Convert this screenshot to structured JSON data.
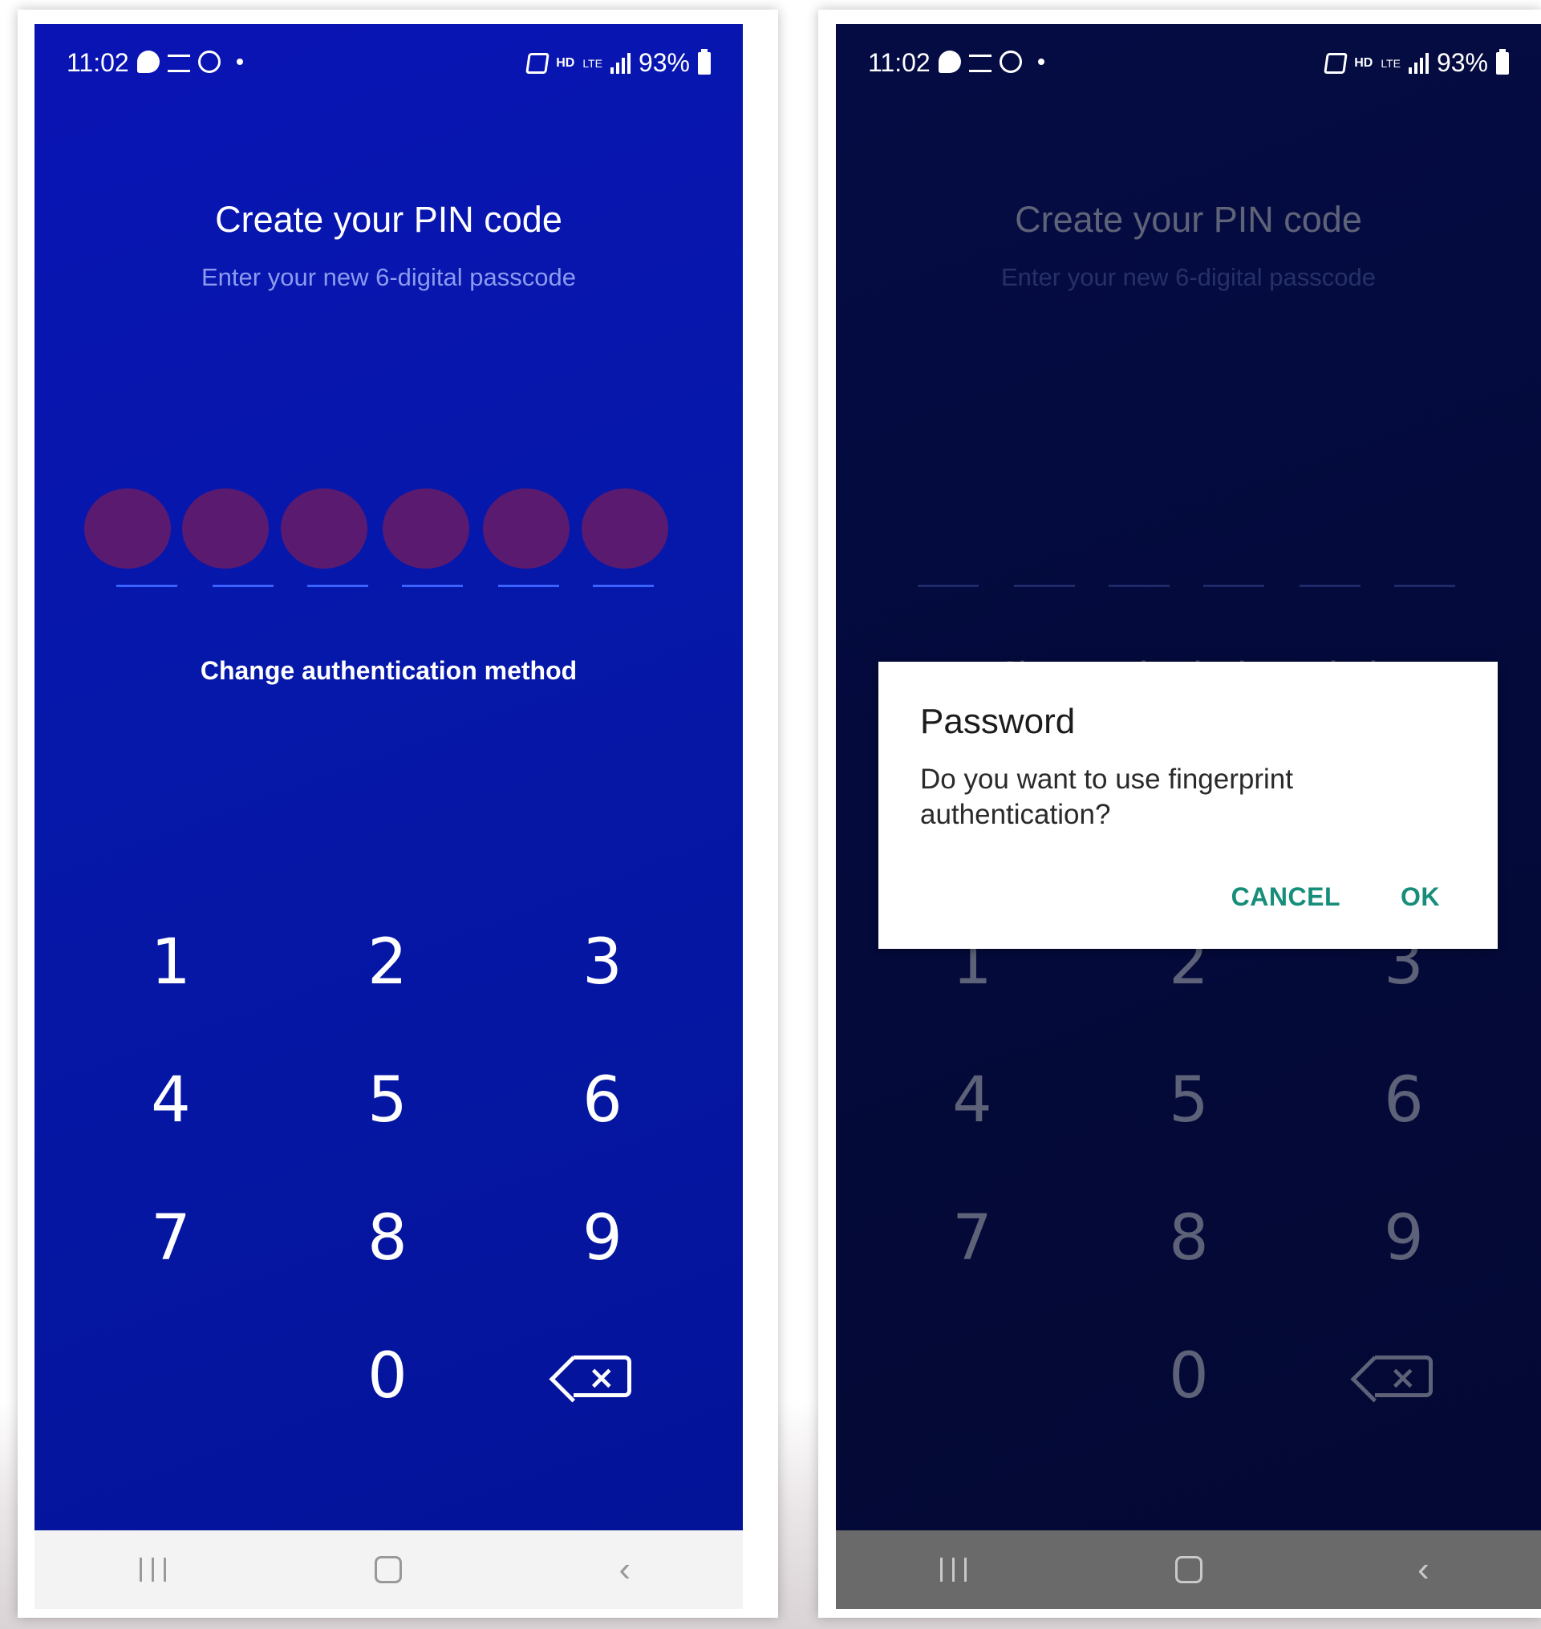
{
  "screens": [
    {
      "status": {
        "time": "11:02",
        "battery": "93%",
        "hd": "HD",
        "lte": "LTE"
      },
      "title": "Create your PIN code",
      "subtitle": "Enter your new 6-digital passcode",
      "pin_length": 6,
      "change_auth": "Change authentication method",
      "keys": [
        "1",
        "2",
        "3",
        "4",
        "5",
        "6",
        "7",
        "8",
        "9",
        "0"
      ],
      "backspace_icon": "backspace-icon",
      "nav": {
        "recents_icon": "recents-icon",
        "home_icon": "home-icon",
        "back_icon": "back-icon"
      }
    },
    {
      "status": {
        "time": "11:02",
        "battery": "93%",
        "hd": "HD",
        "lte": "LTE"
      },
      "title": "Create your PIN code",
      "subtitle": "Enter your new 6-digital passcode",
      "pin_length": 6,
      "change_auth": "Change authentication method",
      "keys": [
        "1",
        "2",
        "3",
        "4",
        "5",
        "6",
        "7",
        "8",
        "9",
        "0"
      ],
      "backspace_icon": "backspace-icon",
      "nav": {
        "recents_icon": "recents-icon",
        "home_icon": "home-icon",
        "back_icon": "back-icon"
      },
      "dialog": {
        "title": "Password",
        "message": "Do you want to use fingerprint authentication?",
        "cancel": "CANCEL",
        "ok": "OK",
        "accent_color": "#178e7a"
      }
    }
  ],
  "colors": {
    "primary_bg": "#0a14b4",
    "dimmed_bg": "#050c44",
    "pin_dot": "#5a1a70"
  }
}
